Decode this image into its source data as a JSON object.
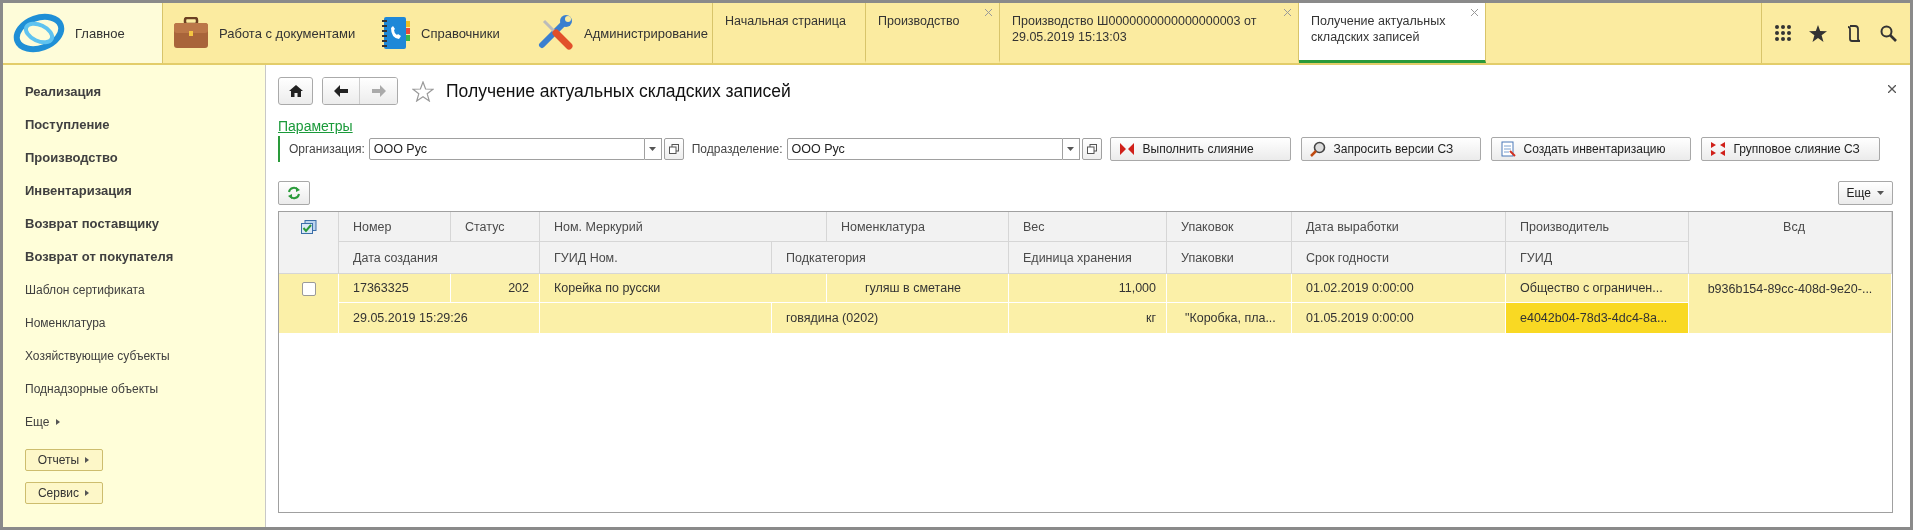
{
  "top_sections": [
    {
      "label": "Главное",
      "selected": true
    },
    {
      "label": "Работа с документами",
      "selected": false
    },
    {
      "label": "Справочники",
      "selected": false
    },
    {
      "label": "Администрирование",
      "selected": false
    }
  ],
  "open_tabs": [
    {
      "label": "Начальная страница",
      "selected": false,
      "closable": false
    },
    {
      "label": "Производство",
      "selected": false,
      "closable": true
    },
    {
      "label": "Производство Ш0000000000000000003 от 29.05.2019 15:13:03",
      "selected": false,
      "closable": true
    },
    {
      "label": "Получение актуальных складских записей",
      "selected": true,
      "closable": true
    }
  ],
  "sidebar": {
    "items": [
      {
        "label": "Реализация",
        "kind": "section"
      },
      {
        "label": "Поступление",
        "kind": "section"
      },
      {
        "label": "Производство",
        "kind": "section"
      },
      {
        "label": "Инвентаризация",
        "kind": "section"
      },
      {
        "label": "Возврат поставщику",
        "kind": "section"
      },
      {
        "label": "Возврат от покупателя",
        "kind": "section"
      },
      {
        "label": "Шаблон сертификата",
        "kind": "link"
      },
      {
        "label": "Номенклатура",
        "kind": "link"
      },
      {
        "label": "Хозяйствующие субъекты",
        "kind": "link"
      },
      {
        "label": "Поднадзорные объекты",
        "kind": "link"
      }
    ],
    "more": "Еще",
    "buttons": [
      "Отчеты",
      "Сервис"
    ]
  },
  "form": {
    "title": "Получение актуальных складских записей",
    "params_link": "Параметры",
    "fields": [
      {
        "label": "Организация:",
        "value": "ООО Рус"
      },
      {
        "label": "Подразделение:",
        "value": "ООО Рус"
      }
    ],
    "actions": [
      "Выполнить слияние",
      "Запросить версии СЗ",
      "Создать инвентаризацию",
      "Групповое слияние СЗ"
    ],
    "more_button": "Еще"
  },
  "table": {
    "header_row_1": [
      "Номер",
      "Статус",
      "Ном. Меркурий",
      "Номенклатура",
      "Вес",
      "Упаковок",
      "Дата выработки",
      "Производитель",
      "Всд"
    ],
    "header_row_2": [
      "Дата создания",
      "ГУИД Ном.",
      "Подкатегория",
      "Единица хранения",
      "Упаковки",
      "Срок годности",
      "ГУИД"
    ],
    "rows": [
      {
        "checked": false,
        "selected": true,
        "line_1": [
          {
            "text": "17363325",
            "selected": false
          },
          {
            "text": "202",
            "selected": false
          },
          {
            "text": "Корейка по русски",
            "selected": false
          },
          {
            "text": "гуляш в сметане",
            "selected": false
          },
          {
            "text": "11,000",
            "selected": false
          },
          {
            "selected": false
          },
          {
            "text": "01.02.2019 0:00:00",
            "selected": false
          },
          {
            "text": "Общество с ограничен...",
            "selected": false
          },
          {
            "text": "b936b154-89cc-408d-9e20-...",
            "selected": false
          }
        ],
        "line_2": [
          {
            "text": "29.05.2019 15:29:26",
            "selected": false
          },
          {
            "selected": false
          },
          {
            "text": "говядина (0202)",
            "selected": false
          },
          {
            "text": "кг",
            "selected": false
          },
          {
            "text": "\"Коробка, пла...",
            "selected": false
          },
          {
            "text": "01.05.2019 0:00:00",
            "selected": false
          },
          {
            "text": "e4042b04-78d3-4dc4-8a...",
            "selected": true
          }
        ]
      }
    ]
  }
}
